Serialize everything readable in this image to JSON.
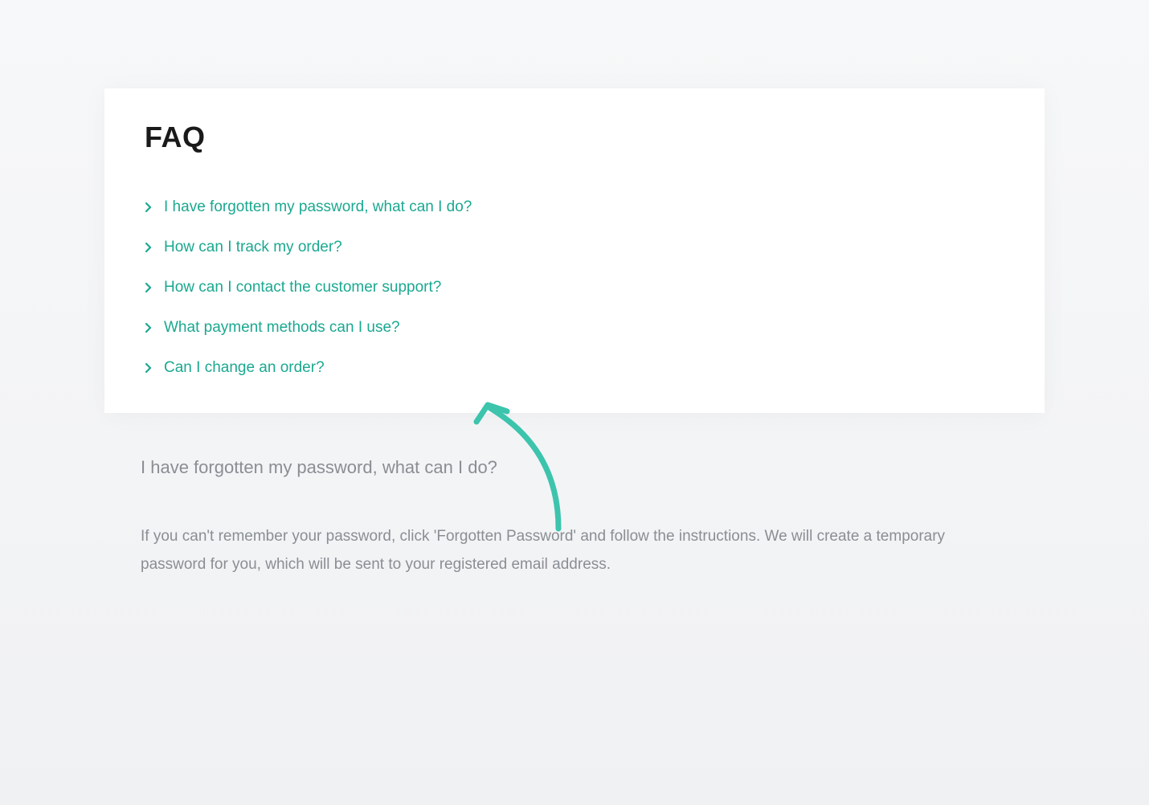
{
  "faq": {
    "title": "FAQ",
    "items": [
      {
        "question": "I have forgotten my password, what can I do?"
      },
      {
        "question": "How can I track my order?"
      },
      {
        "question": "How can I contact the customer support?"
      },
      {
        "question": "What payment methods can I use?"
      },
      {
        "question": "Can I change an order?"
      }
    ]
  },
  "answer": {
    "title": "I have forgotten my password, what can I do?",
    "body": "If you can't remember your password, click 'Forgotten Password' and follow the instructions. We will create a temporary password for you, which will be sent to your registered email address."
  },
  "colors": {
    "accent": "#1ba890",
    "text_muted": "#8a8e93"
  }
}
